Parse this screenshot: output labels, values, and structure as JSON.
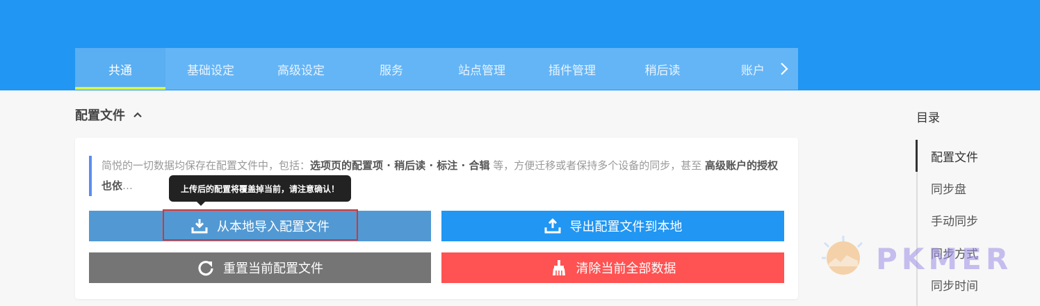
{
  "tabs": [
    {
      "label": "共通",
      "active": true
    },
    {
      "label": "基础设定"
    },
    {
      "label": "高级设定"
    },
    {
      "label": "服务"
    },
    {
      "label": "站点管理"
    },
    {
      "label": "插件管理"
    },
    {
      "label": "稍后读"
    },
    {
      "label": "账户"
    }
  ],
  "section": {
    "title": "配置文件"
  },
  "description": {
    "p1": "简悦的一切数据均保存在配置文件中，包括：",
    "b1": "选项页的配置项 · 稍后读 · 标注 · 合辑",
    "p2": " 等，方便迁移或者保持多个设备的同步，甚至 ",
    "b2": "高级账户的授权也依",
    "p3": "…"
  },
  "tooltip": "上传后的配置将覆盖掉当前，请注意确认！",
  "buttons": {
    "import": "从本地导入配置文件",
    "export": "导出配置文件到本地",
    "reset": "重置当前配置文件",
    "clear": "清除当前全部数据"
  },
  "toc": {
    "title": "目录",
    "items": [
      "配置文件",
      "同步盘",
      "手动同步",
      "同步方式",
      "同步时间"
    ]
  },
  "watermark": "PKMER",
  "colors": {
    "header": "#2196f3",
    "tabbar": "#64b5f6",
    "active_underline": "#d6f542",
    "danger": "#ff5252",
    "primary": "#2196f3"
  }
}
